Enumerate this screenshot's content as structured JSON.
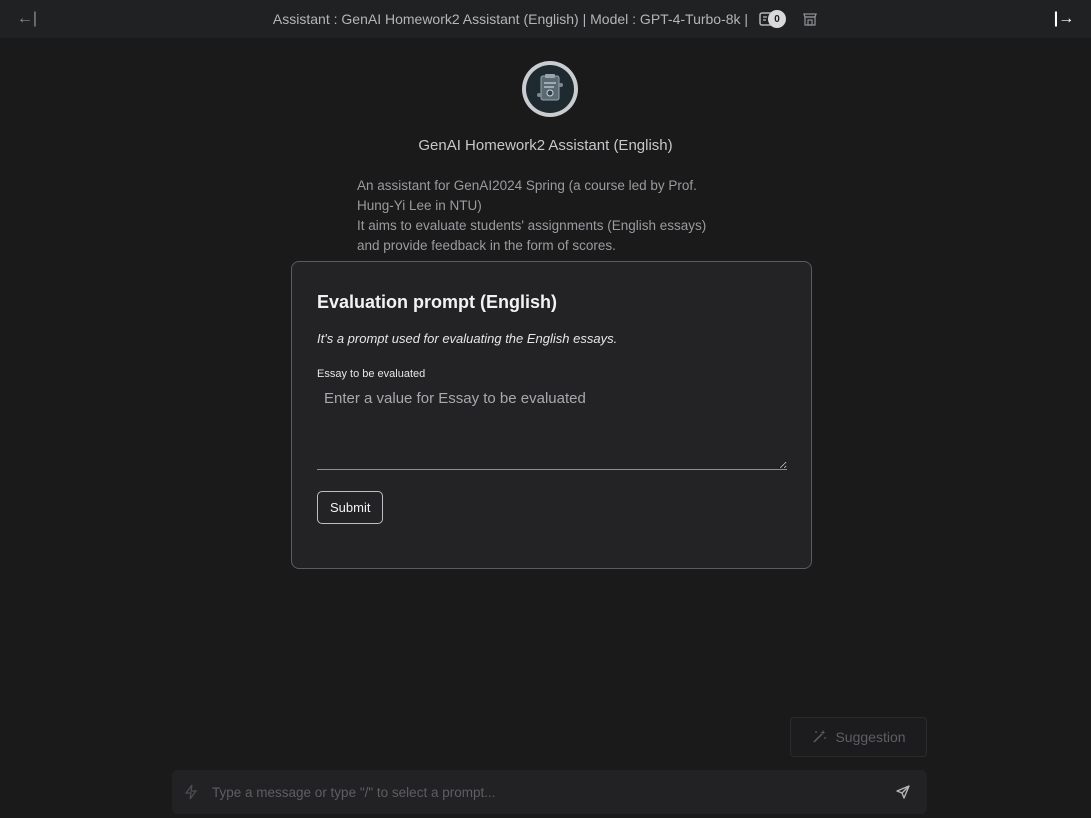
{
  "header": {
    "left_arrow": "←|",
    "right_arrow": "|→",
    "title": "Assistant : GenAI Homework2 Assistant (English) | Model : GPT-4-Turbo-8k |",
    "doc_count": "0"
  },
  "assistant": {
    "name": "GenAI Homework2 Assistant (English)",
    "description_lines": [
      "An assistant for GenAI2024 Spring (a course led by Prof.",
      "Hung-Yi Lee in NTU)",
      "It aims to evaluate students' assignments (English essays)",
      "and provide feedback in the form of scores."
    ]
  },
  "dialog": {
    "title": "Evaluation prompt (English)",
    "subtitle": "It's a prompt used for evaluating the English essays.",
    "field_label": "Essay to be evaluated",
    "field_placeholder": "Enter a value for Essay to be evaluated",
    "field_value": "",
    "submit_label": "Submit"
  },
  "suggestion": {
    "label": "Suggestion"
  },
  "composer": {
    "placeholder": "Type a message or type \"/\" to select a prompt...",
    "value": ""
  },
  "icons": {
    "collapse_left": "arrow-left-bar-icon",
    "expand_right": "bar-arrow-right-icon",
    "documents": "document-icon",
    "store": "store-icon",
    "avatar": "assistant-avatar-icon",
    "wand": "magic-wand-icon",
    "zap": "lightning-icon",
    "send": "send-icon"
  },
  "colors": {
    "background": "#1a1a1b",
    "topbar": "#202123",
    "dialog": "#232325",
    "dialog_border": "#5b5b60"
  }
}
